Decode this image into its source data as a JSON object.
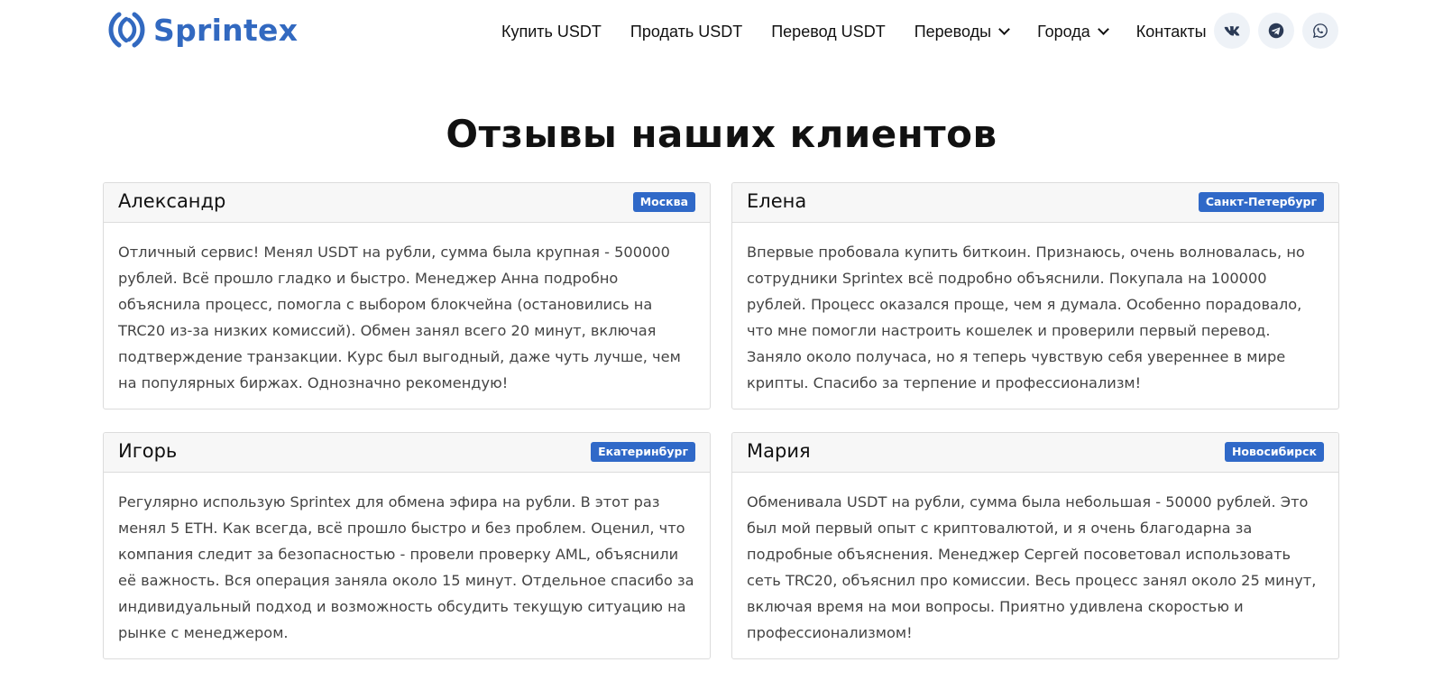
{
  "header": {
    "brand": "Sprintex",
    "brand_color": "#3269c0",
    "nav": [
      {
        "label": "Купить USDT",
        "has_dropdown": false
      },
      {
        "label": "Продать USDT",
        "has_dropdown": false
      },
      {
        "label": "Перевод USDT",
        "has_dropdown": false
      },
      {
        "label": "Переводы",
        "has_dropdown": true
      },
      {
        "label": "Города",
        "has_dropdown": true
      },
      {
        "label": "Контакты",
        "has_dropdown": false
      }
    ],
    "social": [
      "vk-icon",
      "telegram-icon",
      "whatsapp-icon"
    ]
  },
  "main": {
    "title": "Отзывы наших клиентов",
    "badge_color": "#3069c8",
    "reviews": [
      {
        "name": "Александр",
        "city": "Москва",
        "text": "Отличный сервис! Менял USDT на рубли, сумма была крупная - 500000 рублей. Всё прошло гладко и быстро. Менеджер Анна подробно объяснила процесс, помогла с выбором блокчейна (остановились на TRC20 из-за низких комиссий). Обмен занял всего 20 минут, включая подтверждение транзакции. Курс был выгодный, даже чуть лучше, чем на популярных биржах. Однозначно рекомендую!"
      },
      {
        "name": "Елена",
        "city": "Санкт-Петербург",
        "text": "Впервые пробовала купить биткоин. Признаюсь, очень волновалась, но сотрудники Sprintex всё подробно объяснили. Покупала на 100000 рублей. Процесс оказался проще, чем я думала. Особенно порадовало, что мне помогли настроить кошелек и проверили первый перевод. Заняло около получаса, но я теперь чувствую себя увереннее в мире крипты. Спасибо за терпение и профессионализм!"
      },
      {
        "name": "Игорь",
        "city": "Екатеринбург",
        "text": "Регулярно использую Sprintex для обмена эфира на рубли. В этот раз менял 5 ETH. Как всегда, всё прошло быстро и без проблем. Оценил, что компания следит за безопасностью - провели проверку AML, объяснили её важность. Вся операция заняла около 15 минут. Отдельное спасибо за индивидуальный подход и возможность обсудить текущую ситуацию на рынке с менеджером."
      },
      {
        "name": "Мария",
        "city": "Новосибирск",
        "text": "Обменивала USDT на рубли, сумма была небольшая - 50000 рублей. Это был мой первый опыт с криптовалютой, и я очень благодарна за подробные объяснения. Менеджер Сергей посоветовал использовать сеть TRC20, объяснил про комиссии. Весь процесс занял около 25 минут, включая время на мои вопросы. Приятно удивлена скоростью и профессионализмом!"
      }
    ]
  }
}
